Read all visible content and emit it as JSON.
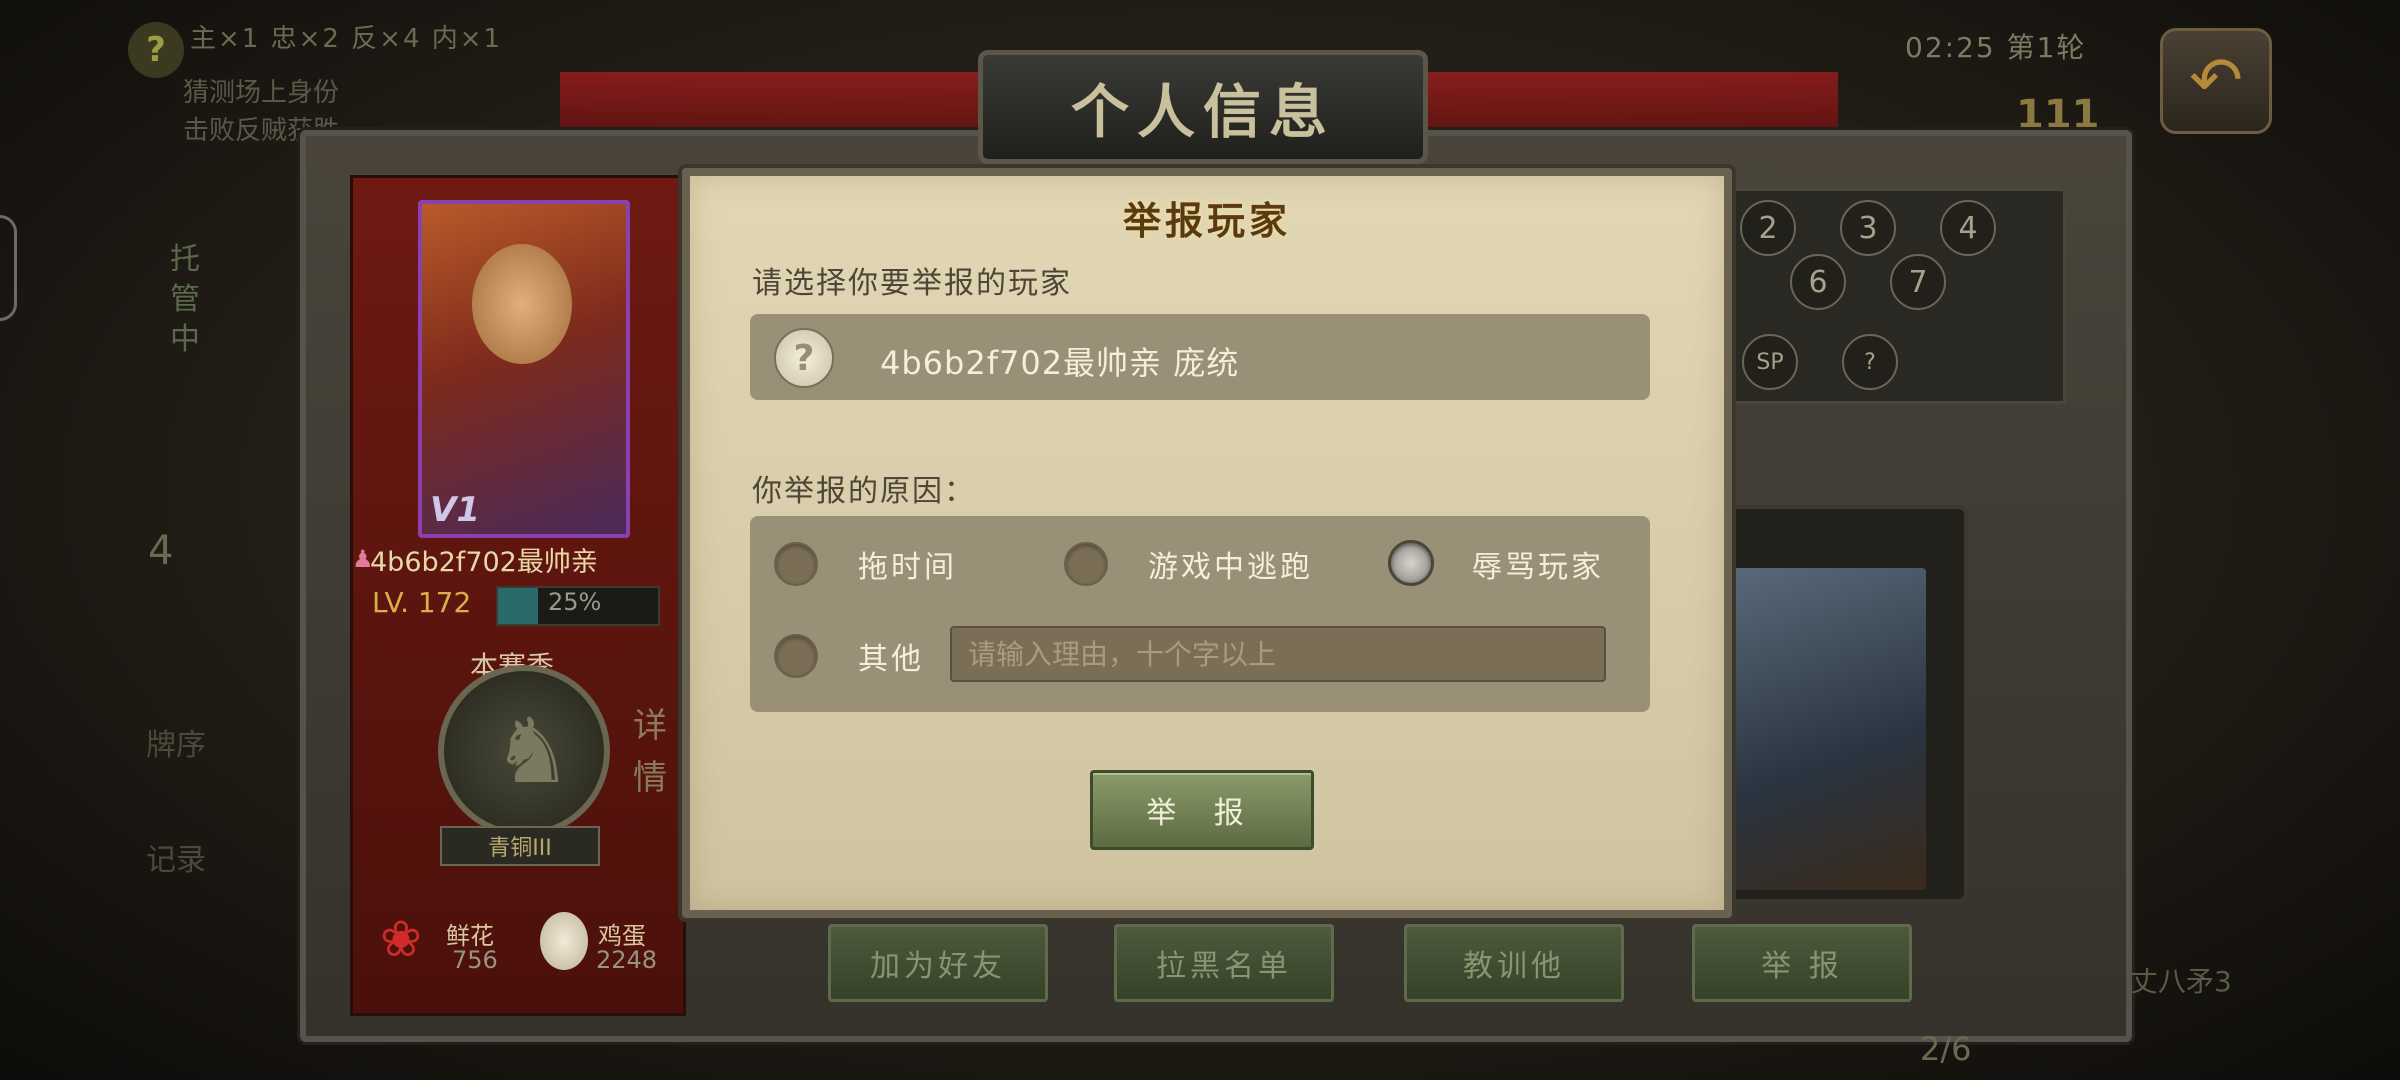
{
  "top_bar": {
    "stats": "主×1 忠×2 反×4 内×1",
    "hint1": "猜测场上身份",
    "hint2": "击败反贼获胜",
    "timer": "02:25 第1轮",
    "count": "111"
  },
  "panel": {
    "title": "个人信息"
  },
  "profile": {
    "vip": "V1",
    "name": "4b6b2f702最帅亲",
    "level": "LV. 172",
    "exp_percent_text": "25%",
    "exp_fraction": 0.25,
    "season_label": "本赛季",
    "rank": "青铜III",
    "detail_label": "详情",
    "flower_label": "鲜花",
    "flower_count": "756",
    "egg_label": "鸡蛋",
    "egg_count": "2248"
  },
  "stars": [
    "2",
    "3",
    "4",
    "6",
    "7",
    "SP",
    "?"
  ],
  "actions": [
    "加为好友",
    "拉黑名单",
    "教训他",
    "举 报"
  ],
  "side": {
    "left_tag": "托管中",
    "left_count": "4",
    "sort": "牌序",
    "record": "记录",
    "right_label": "丈八矛3",
    "page": "2/6"
  },
  "dialog": {
    "title": "举报玩家",
    "prompt": "请选择你要举报的玩家",
    "player_name": "4b6b2f702最帅亲  庞统",
    "player_avatar": "?",
    "reason_label": "你举报的原因：",
    "reasons": [
      {
        "label": "拖时间",
        "checked": false
      },
      {
        "label": "游戏中逃跑",
        "checked": false
      },
      {
        "label": "辱骂玩家",
        "checked": true
      },
      {
        "label": "其他",
        "checked": false
      }
    ],
    "other_placeholder": "请输入理由，十个字以上",
    "submit_label": "举 报"
  },
  "colors": {
    "dialog_bg": "#d8cdaa",
    "row_bg": "#9a8f77",
    "accent_red": "#a81e1e",
    "button_green": "#6c7c4e"
  }
}
